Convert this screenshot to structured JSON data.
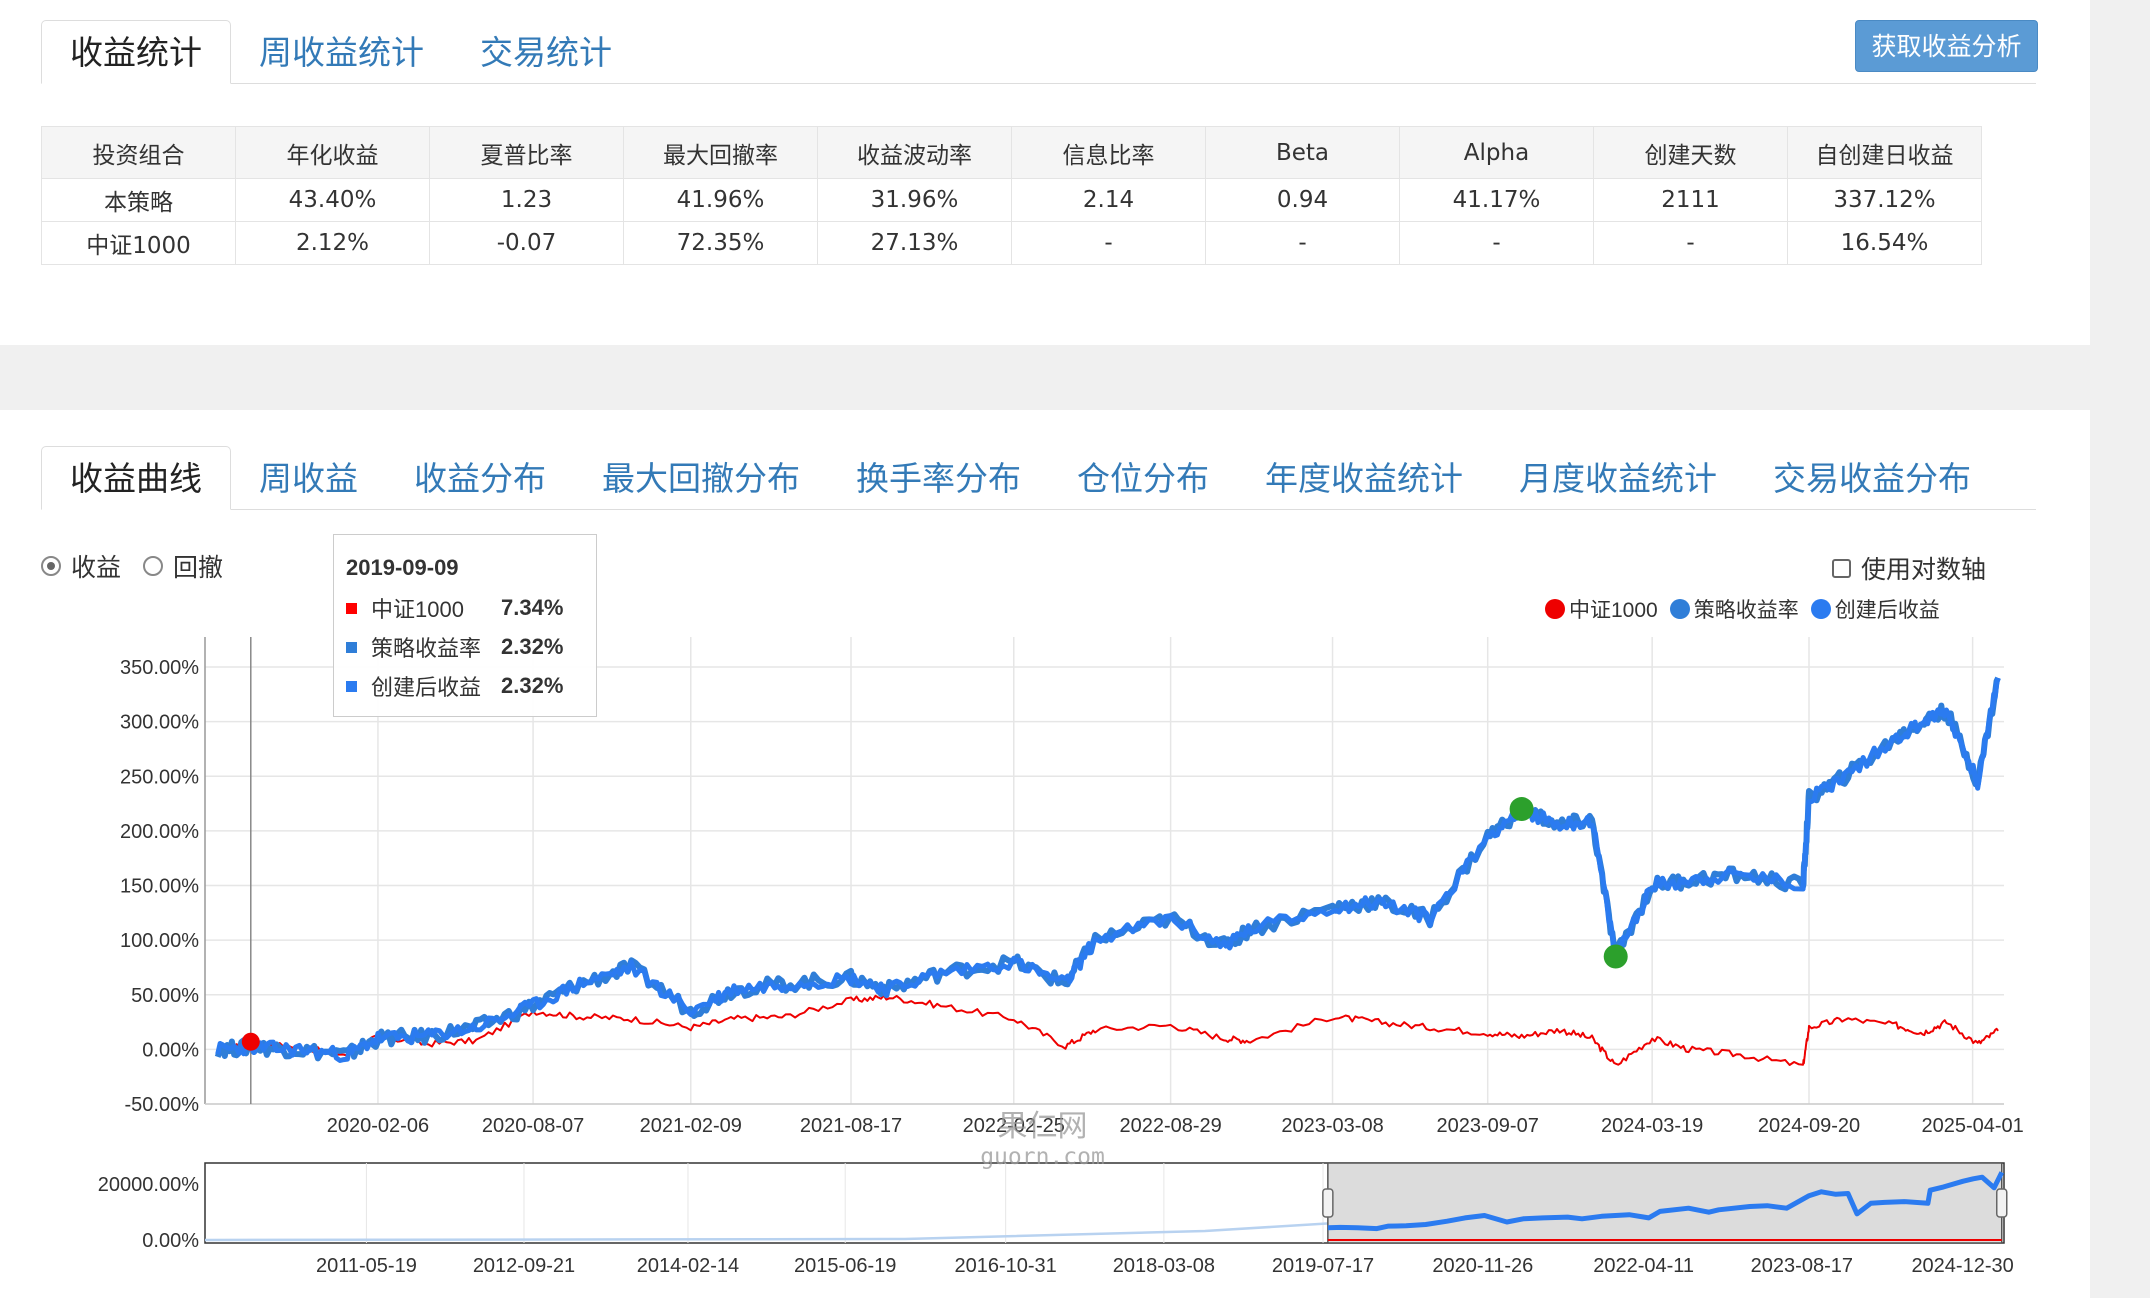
{
  "top_tabs": [
    {
      "label": "收益统计",
      "active": true
    },
    {
      "label": "周收益统计",
      "active": false
    },
    {
      "label": "交易统计",
      "active": false
    }
  ],
  "analysis_button": "获取收益分析",
  "stats_table": {
    "headers": [
      "投资组合",
      "年化收益",
      "夏普比率",
      "最大回撤率",
      "收益波动率",
      "信息比率",
      "Beta",
      "Alpha",
      "创建天数",
      "自创建日收益"
    ],
    "rows": [
      [
        "本策略",
        "43.40%",
        "1.23",
        "41.96%",
        "31.96%",
        "2.14",
        "0.94",
        "41.17%",
        "2111",
        "337.12%"
      ],
      [
        "中证1000",
        "2.12%",
        "-0.07",
        "72.35%",
        "27.13%",
        "-",
        "-",
        "-",
        "-",
        "16.54%"
      ]
    ]
  },
  "chart_tabs": [
    {
      "label": "收益曲线",
      "active": true
    },
    {
      "label": "周收益",
      "active": false
    },
    {
      "label": "收益分布",
      "active": false
    },
    {
      "label": "最大回撤分布",
      "active": false
    },
    {
      "label": "换手率分布",
      "active": false
    },
    {
      "label": "仓位分布",
      "active": false
    },
    {
      "label": "年度收益统计",
      "active": false
    },
    {
      "label": "月度收益统计",
      "active": false
    },
    {
      "label": "交易收益分布",
      "active": false
    }
  ],
  "radios": [
    {
      "label": "收益",
      "checked": true
    },
    {
      "label": "回撤",
      "checked": false
    }
  ],
  "log_axis": {
    "label": "使用对数轴",
    "checked": false
  },
  "tooltip": {
    "date": "2019-09-09",
    "rows": [
      {
        "name": "中证1000",
        "value": "7.34%",
        "color": "#ff0000"
      },
      {
        "name": "策略收益率",
        "value": "2.32%",
        "color": "#2f7ed8"
      },
      {
        "name": "创建后收益",
        "value": "2.32%",
        "color": "#2b7bf0"
      }
    ]
  },
  "legend": [
    {
      "name": "中证1000",
      "color": "#ee0000"
    },
    {
      "name": "策略收益率",
      "color": "#2f7ed8"
    },
    {
      "name": "创建后收益",
      "color": "#2b7bf0"
    }
  ],
  "watermark": {
    "line1": "果仁网",
    "line2": "guorn.com"
  },
  "chart_data": {
    "type": "line",
    "y_ticks": [
      "350.00%",
      "300.00%",
      "250.00%",
      "200.00%",
      "150.00%",
      "100.00%",
      "50.00%",
      "0.00%",
      "-50.00%"
    ],
    "ylim": [
      -50,
      350
    ],
    "x_ticks": [
      "2020-02-06",
      "2020-08-07",
      "2021-02-09",
      "2021-08-17",
      "2022-02-25",
      "2022-08-29",
      "2023-03-08",
      "2023-09-07",
      "2024-03-19",
      "2024-09-20",
      "2025-04-01"
    ],
    "x": [
      "2019-08-01",
      "2019-09-09",
      "2019-11-01",
      "2020-01-01",
      "2020-02-06",
      "2020-04-01",
      "2020-06-01",
      "2020-08-07",
      "2020-10-01",
      "2020-12-01",
      "2021-02-09",
      "2021-04-01",
      "2021-06-01",
      "2021-08-17",
      "2021-10-01",
      "2021-12-01",
      "2022-02-25",
      "2022-04-27",
      "2022-06-01",
      "2022-08-29",
      "2022-10-31",
      "2022-12-01",
      "2023-03-08",
      "2023-05-01",
      "2023-07-01",
      "2023-09-07",
      "2023-10-17",
      "2023-12-01",
      "2024-01-08",
      "2024-02-05",
      "2024-03-19",
      "2024-05-01",
      "2024-07-01",
      "2024-09-13",
      "2024-09-20",
      "2024-11-01",
      "2025-01-01",
      "2025-02-01",
      "2025-03-01",
      "2025-04-07",
      "2025-05-01"
    ],
    "series": [
      {
        "name": "中证1000",
        "values": [
          0,
          7,
          2,
          -5,
          12,
          5,
          8,
          35,
          30,
          28,
          20,
          28,
          30,
          45,
          48,
          40,
          28,
          3,
          18,
          22,
          10,
          8,
          30,
          25,
          20,
          15,
          12,
          18,
          10,
          -15,
          10,
          0,
          -5,
          -15,
          20,
          28,
          22,
          15,
          25,
          5,
          17
        ]
      },
      {
        "name": "策略收益率",
        "values": [
          0,
          2,
          0,
          -5,
          10,
          12,
          20,
          40,
          60,
          75,
          35,
          55,
          60,
          65,
          55,
          70,
          80,
          60,
          100,
          120,
          95,
          110,
          130,
          135,
          120,
          195,
          220,
          205,
          210,
          85,
          150,
          155,
          160,
          150,
          230,
          250,
          285,
          300,
          310,
          245,
          340
        ]
      },
      {
        "name": "创建后收益",
        "values": [
          0,
          2,
          0,
          -5,
          10,
          12,
          20,
          40,
          60,
          75,
          35,
          55,
          60,
          65,
          55,
          70,
          80,
          60,
          100,
          120,
          95,
          110,
          130,
          135,
          120,
          195,
          220,
          205,
          210,
          85,
          150,
          155,
          160,
          150,
          230,
          250,
          285,
          300,
          310,
          245,
          340
        ]
      }
    ],
    "markers": [
      {
        "x": "2019-09-09",
        "y": 7,
        "series": "中证1000"
      },
      {
        "x": "2023-10-17",
        "y": 220,
        "series": "创建后收益",
        "label": "max"
      },
      {
        "x": "2024-02-05",
        "y": 85,
        "series": "创建后收益",
        "label": "min"
      }
    ],
    "navigator": {
      "y_ticks": [
        "20000.00%",
        "0.00%"
      ],
      "x_ticks": [
        "2011-05-19",
        "2012-09-21",
        "2014-02-14",
        "2015-06-19",
        "2016-10-31",
        "2018-03-08",
        "2019-07-17",
        "2020-11-26",
        "2022-04-11",
        "2023-08-17",
        "2024-12-30"
      ],
      "selected_range": [
        "2019-08-01",
        "2025-05-01"
      ]
    }
  }
}
